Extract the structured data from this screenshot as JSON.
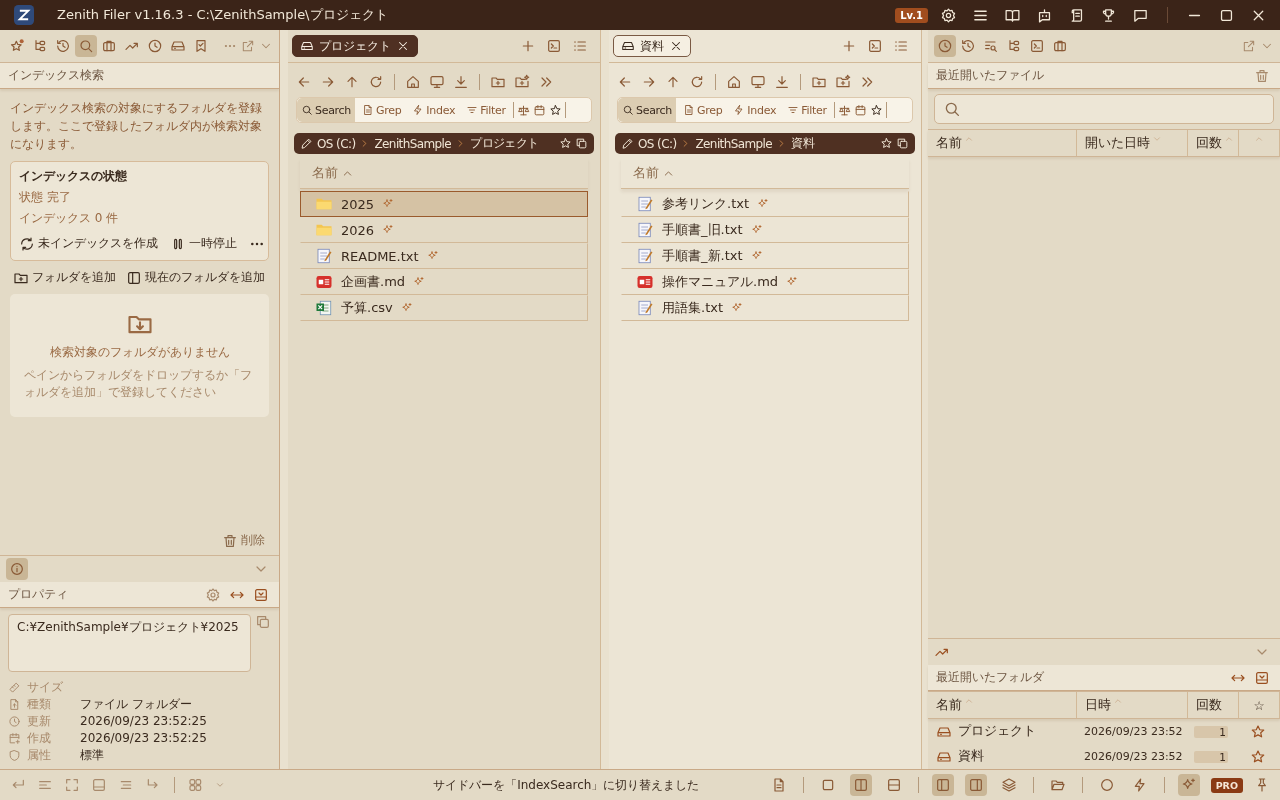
{
  "window": {
    "title": "Zenith Filer v1.16.3 - C:\\ZenithSample\\プロジェクト",
    "level_badge": "Lv.1"
  },
  "left_sidebar": {
    "tools": [
      {
        "kind": "starbadge",
        "selected": false
      },
      {
        "kind": "tree",
        "selected": false
      },
      {
        "kind": "history",
        "selected": false
      },
      {
        "kind": "search",
        "selected": true
      },
      {
        "kind": "briefcase",
        "selected": false
      },
      {
        "kind": "trend",
        "selected": false
      },
      {
        "kind": "clock",
        "selected": false
      },
      {
        "kind": "drive",
        "selected": false
      },
      {
        "kind": "bookmark",
        "selected": false
      }
    ],
    "section_title": "インデックス検索",
    "description": "インデックス検索の対象にするフォルダを登録します。ここで登録したフォルダ内が検索対象になります。",
    "status_card": {
      "title": "インデックスの状態",
      "status": "状態 完了",
      "count": "インデックス 0 件",
      "rebuild": "未インデックスを作成",
      "pause": "一時停止"
    },
    "add_folder": "フォルダを追加",
    "add_current": "現在のフォルダを追加",
    "empty": {
      "title": "検索対象のフォルダがありません",
      "hint": "ペインからフォルダをドロップするか「フォルダを追加」で登録してください"
    },
    "delete": "削除"
  },
  "properties": {
    "title": "プロパティ",
    "path": "C:¥ZenithSample¥プロジェクト¥2025",
    "rows": [
      {
        "kind": "size",
        "label": "サイズ"
      },
      {
        "kind": "type",
        "label": "種類",
        "value": "ファイル フォルダー"
      },
      {
        "kind": "modified",
        "label": "更新",
        "value": "2026/09/23 23:52:25"
      },
      {
        "kind": "created",
        "label": "作成",
        "value": "2026/09/23 23:52:25"
      },
      {
        "kind": "attribute",
        "label": "属性",
        "value": "標準"
      }
    ]
  },
  "panes": [
    {
      "tab": {
        "label": "プロジェクト",
        "selected": true
      },
      "search_modes": [
        {
          "kind": "search",
          "label": "Search",
          "selected": true
        },
        {
          "kind": "file",
          "label": "Grep",
          "selected": false
        },
        {
          "kind": "bolt",
          "label": "Index",
          "selected": false
        },
        {
          "kind": "filter",
          "label": "Filter",
          "selected": false
        }
      ],
      "breadcrumb": [
        "OS (C:)",
        "ZenithSample",
        "プロジェクト"
      ],
      "column": "名前",
      "files": [
        {
          "name": "2025",
          "kind": "folder",
          "selected": true
        },
        {
          "name": "2026",
          "kind": "folder",
          "selected": false
        },
        {
          "name": "README.txt",
          "kind": "text",
          "selected": false
        },
        {
          "name": "企画書.md",
          "kind": "markdown",
          "selected": false
        },
        {
          "name": "予算.csv",
          "kind": "spreadsheet",
          "selected": false
        }
      ]
    },
    {
      "tab": {
        "label": "資料",
        "selected": false
      },
      "search_modes": [
        {
          "kind": "search",
          "label": "Search",
          "selected": true
        },
        {
          "kind": "file",
          "label": "Grep",
          "selected": false
        },
        {
          "kind": "bolt",
          "label": "Index",
          "selected": false
        },
        {
          "kind": "filter",
          "label": "Filter",
          "selected": false
        }
      ],
      "breadcrumb": [
        "OS (C:)",
        "ZenithSample",
        "資料"
      ],
      "column": "名前",
      "files": [
        {
          "name": "参考リンク.txt",
          "kind": "text",
          "selected": false
        },
        {
          "name": "手順書_旧.txt",
          "kind": "text",
          "selected": false
        },
        {
          "name": "手順書_新.txt",
          "kind": "text",
          "selected": false
        },
        {
          "name": "操作マニュアル.md",
          "kind": "markdown",
          "selected": false
        },
        {
          "name": "用語集.txt",
          "kind": "text",
          "selected": false
        }
      ]
    }
  ],
  "right_panel": {
    "tools": [
      {
        "kind": "clock",
        "selected": true
      },
      {
        "kind": "history",
        "selected": false
      },
      {
        "kind": "searchlines",
        "selected": false
      },
      {
        "kind": "tree",
        "selected": false
      },
      {
        "kind": "terminal",
        "selected": false
      },
      {
        "kind": "briefcase",
        "selected": false
      }
    ],
    "recent_files": {
      "title": "最近開いたファイル",
      "columns": [
        "名前",
        "開いた日時",
        "回数"
      ]
    },
    "recent_folders": {
      "title": "最近開いたフォルダ",
      "columns": [
        "名前",
        "日時",
        "回数",
        "☆"
      ],
      "rows": [
        {
          "name": "プロジェクト",
          "date": "2026/09/23 23:52",
          "count": "1"
        },
        {
          "name": "資料",
          "date": "2026/09/23 23:52",
          "count": "1"
        }
      ]
    }
  },
  "status_bar": {
    "message": "サイドバーを「IndexSearch」に切り替えました",
    "pro": "PRO",
    "toggle_groups": [
      {
        "items": [
          {
            "kind": "file",
            "selected": false
          }
        ]
      },
      {
        "items": [
          {
            "kind": "square",
            "selected": false
          },
          {
            "kind": "columns",
            "selected": true
          },
          {
            "kind": "rows",
            "selected": false
          }
        ]
      },
      {
        "items": [
          {
            "kind": "sidebarleft",
            "selected": true
          },
          {
            "kind": "sidebarright",
            "selected": true
          },
          {
            "kind": "layers",
            "selected": false
          }
        ]
      },
      {
        "items": [
          {
            "kind": "folderopen",
            "selected": false
          }
        ]
      },
      {
        "items": [
          {
            "kind": "circle",
            "selected": false
          },
          {
            "kind": "bolt",
            "selected": false
          }
        ]
      },
      {
        "items": [
          {
            "kind": "sparkle",
            "selected": true
          }
        ]
      }
    ]
  }
}
